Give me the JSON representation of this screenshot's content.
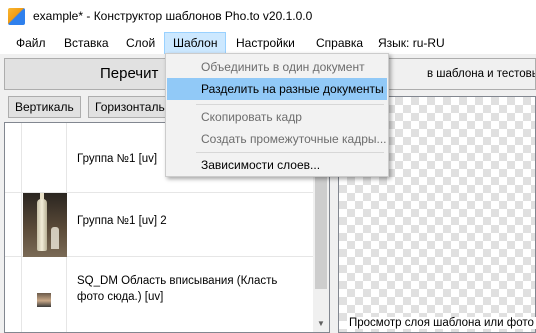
{
  "window": {
    "title": "example* - Конструктор шаблонов Pho.to v20.1.0.0"
  },
  "menubar": {
    "items": [
      "Файл",
      "Вставка",
      "Слой",
      "Шаблон",
      "Настройки",
      "Справка",
      "Язык: ru-RU"
    ],
    "active": "Шаблон"
  },
  "template_menu": {
    "items": [
      {
        "label": "Объединить в один документ",
        "enabled": false,
        "highlighted": false
      },
      {
        "label": "Разделить на разные документы",
        "enabled": true,
        "highlighted": true
      },
      {
        "label": "Скопировать кадр",
        "enabled": false,
        "highlighted": false
      },
      {
        "label": "Создать промежуточные кадры...",
        "enabled": false,
        "highlighted": false
      },
      {
        "label": "Зависимости слоев...",
        "enabled": true,
        "highlighted": false
      }
    ]
  },
  "toolbar": {
    "recalc_label": "Перечит",
    "preview_header": "в шаблона и тестовых"
  },
  "orientation": {
    "vertical_label": "Вертикаль",
    "horizontal_label": "Горизонталь"
  },
  "layers": [
    {
      "name": "Группа №1 [uv]",
      "thumb": "empty"
    },
    {
      "name": "Группа №1 [uv] 2",
      "thumb": "bottle-photo"
    },
    {
      "name": "SQ_DM Область вписывания (Класть фото сюда.) [uv]",
      "thumb": "face-photo"
    }
  ],
  "preview": {
    "caption": "Просмотр слоя шаблона или фото (не"
  }
}
